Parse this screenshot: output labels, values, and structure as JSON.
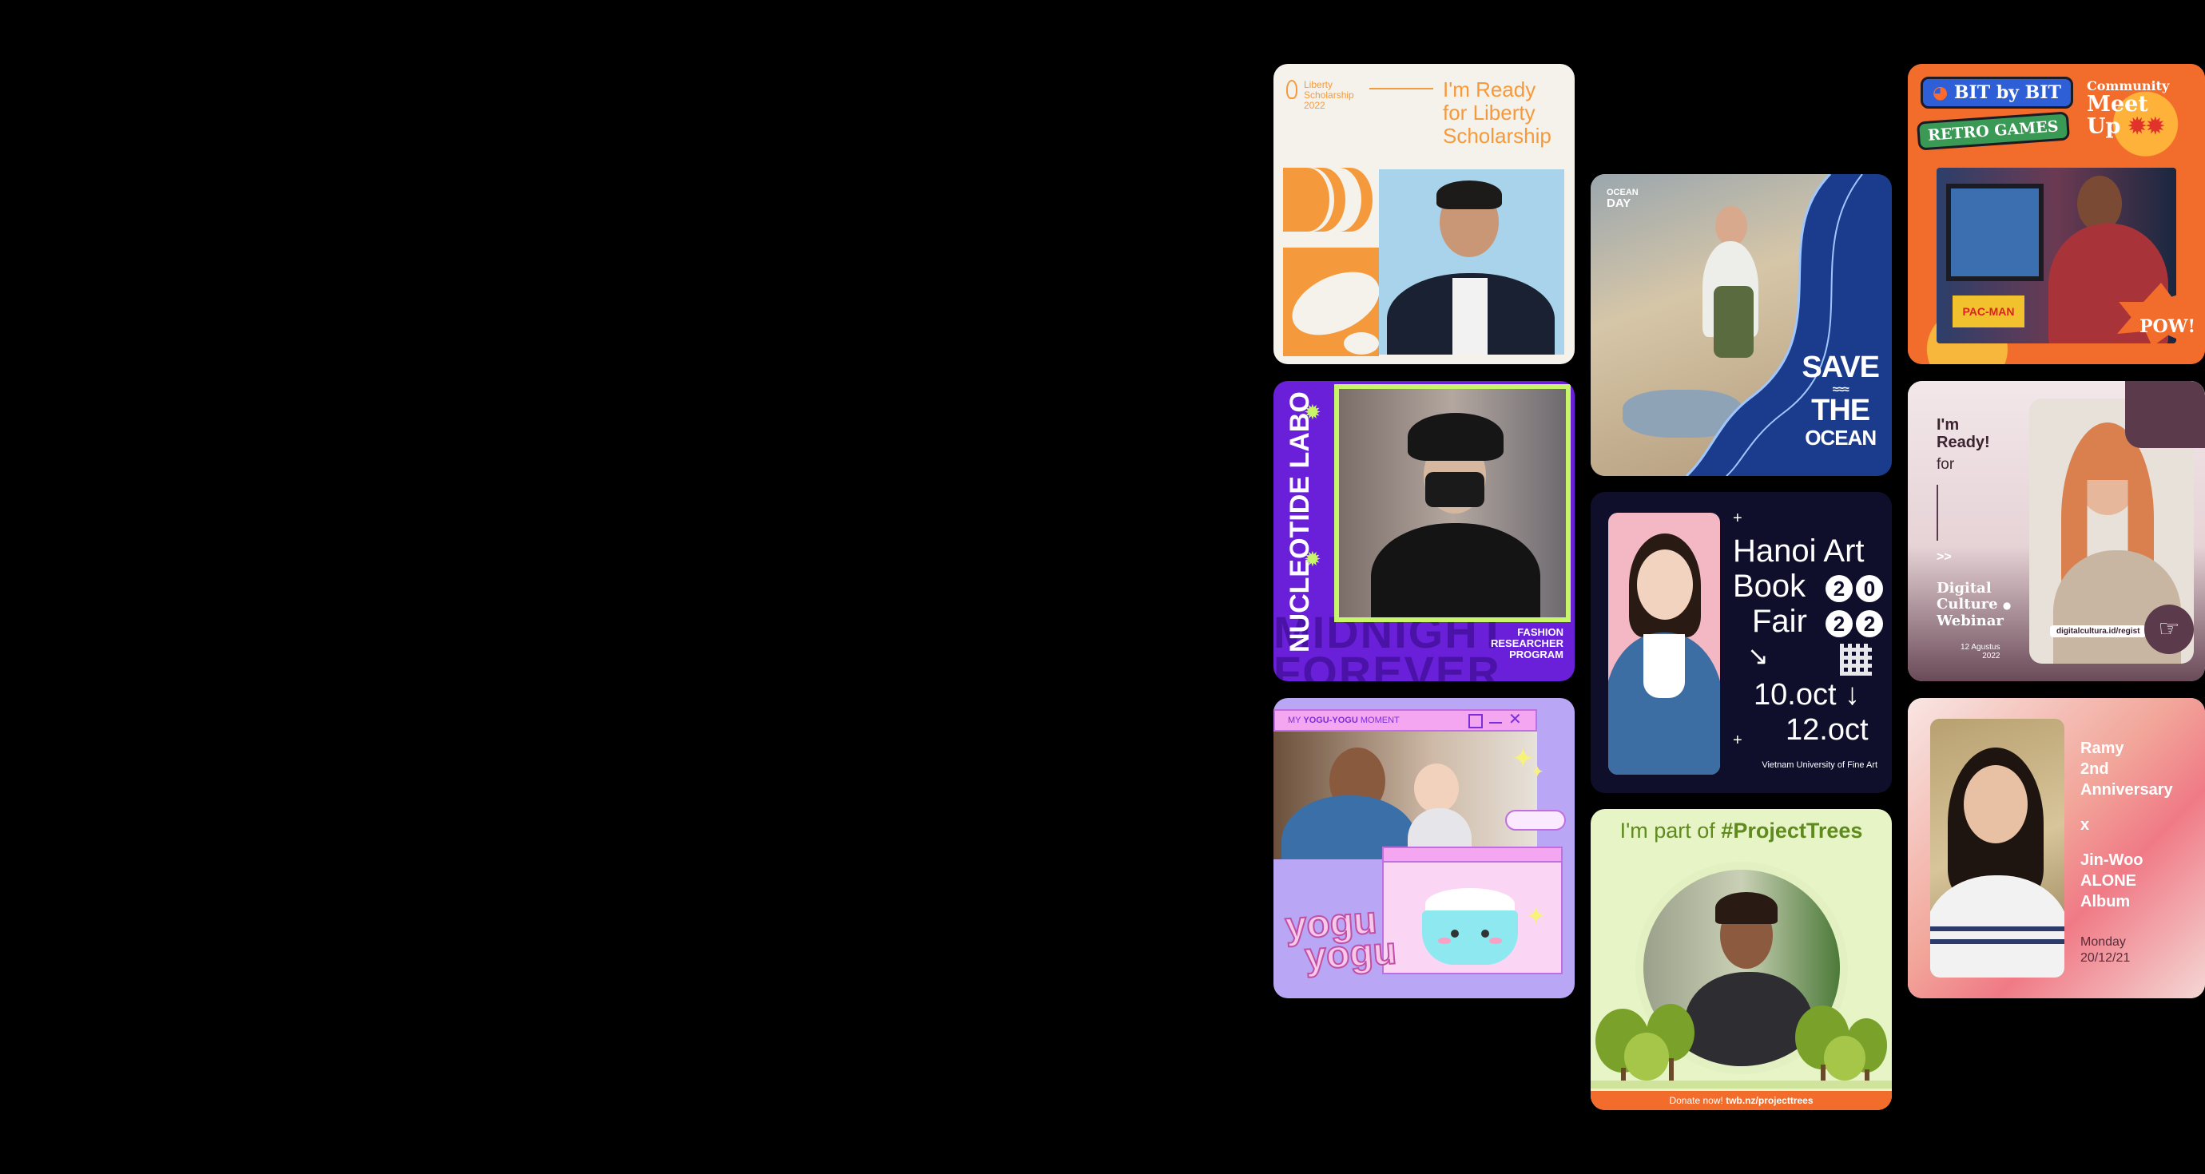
{
  "liberty": {
    "logo_line1": "Liberty",
    "logo_line2": "Scholarship",
    "logo_year": "2022",
    "headline_l1": "I'm Ready",
    "headline_l2": "for Liberty",
    "headline_l3": "Scholarship"
  },
  "nucleotide": {
    "vertical_title": "NUCLEOTIDE LABO",
    "bg_text_1": "MIDNIGHT",
    "bg_text_2": "FOREVER",
    "tag_l1": "FASHION",
    "tag_l2": "RESEARCHER",
    "tag_l3": "PROGRAM"
  },
  "yogu": {
    "window_title_pre": "MY ",
    "window_title_brand": "YOGU-YOGU",
    "window_title_post": " MOMENT",
    "logo_l1": "yogu",
    "logo_l2": "yogu"
  },
  "ocean": {
    "tag_l1": "OCEAN",
    "tag_l2": "DAY",
    "headline_l1": "SAVE",
    "headline_l2": "THE",
    "headline_l3": "OCEAN"
  },
  "hanoi": {
    "title_l1": "Hanoi Art",
    "title_l2": "Book",
    "title_l3": "Fair",
    "year_d1": "2",
    "year_d2": "0",
    "year_d3": "2",
    "year_d4": "2",
    "date_start": "10.oct",
    "date_end": "12.oct",
    "venue": "Vietnam University of Fine Art"
  },
  "trees": {
    "headline_pre": "I'm part of ",
    "headline_tag": "#ProjectTrees",
    "donate_pre": "Donate now! ",
    "donate_url": "twb.nz/projecttrees"
  },
  "retro": {
    "badge_1": "BIT by BIT",
    "badge_2": "RETRO GAMES",
    "meet_l1": "Community",
    "meet_l2": "Meet",
    "meet_l3": "Up",
    "pow": "POW!",
    "arcade": "PAC-MAN"
  },
  "webinar": {
    "ready_l1": "I'm",
    "ready_l2": "Ready!",
    "for": "for",
    "arrows": ">>",
    "title_l1": "Digital",
    "title_l2": "Culture",
    "title_l3": "Webinar",
    "date_l1": "12 Agustus",
    "date_l2": "2022",
    "url": "digitalcultura.id/regist"
  },
  "ramy": {
    "l1": "Ramy",
    "l2": "2nd",
    "l3": "Anniversary",
    "x": "x",
    "l4": "Jin-Woo",
    "l5": "ALONE",
    "l6": "Album",
    "day": "Monday",
    "date": "20/12/21"
  },
  "colors": {
    "background": "#000000",
    "liberty_orange": "#f59a3c",
    "nucleotide_purple": "#6a1fd9",
    "nucleotide_lime": "#c9f56a",
    "yogu_lilac": "#b9a6f4",
    "ocean_blue": "#1b3c8c",
    "hanoi_navy": "#0f0f2c",
    "trees_green": "#5f8a1e",
    "retro_orange": "#f26c2b",
    "webinar_plum": "#5a3a4b",
    "ramy_pink": "#f28a8a"
  }
}
